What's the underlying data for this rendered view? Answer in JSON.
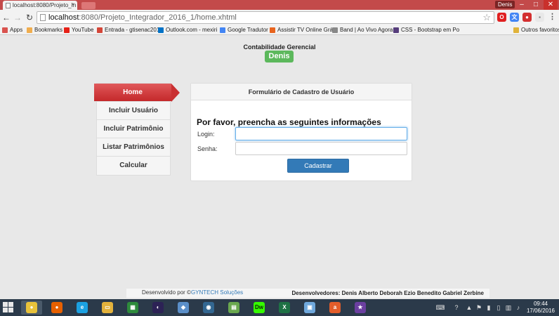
{
  "browser": {
    "tab_title": "localhost:8080/Projeto_In",
    "tab_close": "×",
    "user_badge": "Denis",
    "url_host": "localhost",
    "url_path": ":8080/Projeto_Integrador_2016_1/home.xhtml",
    "bookmarks": [
      {
        "label": "Apps",
        "color": "#d9534f"
      },
      {
        "label": "Bookmarks",
        "color": "#f0ad4e"
      },
      {
        "label": "YouTube",
        "color": "#e62117"
      },
      {
        "label": "Entrada - gtisenac201",
        "color": "#d44638"
      },
      {
        "label": "Outlook.com - mexiri",
        "color": "#0072c6"
      },
      {
        "label": "Google Tradutor",
        "color": "#4285f4"
      },
      {
        "label": "Assistir TV Online Grá",
        "color": "#e8641e"
      },
      {
        "label": "Band | Ao Vivo Agora",
        "color": "#888888"
      },
      {
        "label": "CSS - Bootstrap em Po",
        "color": "#563d7c"
      },
      {
        "label": "Outros favoritos",
        "color": "#e0b33a"
      }
    ]
  },
  "header": {
    "app_title": "Contabilidade Gerencial",
    "user": "Denis"
  },
  "menu": {
    "items": [
      "Home",
      "Incluir Usuário",
      "Incluir Patrimônio",
      "Listar Patrimônios",
      "Calcular"
    ],
    "active_index": 0
  },
  "form": {
    "title": "Formulário de Cadastro de Usuário",
    "intro": "Por favor, preencha as seguintes informações",
    "login_label": "Login:",
    "login_value": "",
    "senha_label": "Senha:",
    "senha_value": "",
    "submit_label": "Cadastrar"
  },
  "footer": {
    "dev_prefix": "Desenvolvido por ©",
    "brand": "GYNTECH Soluções",
    "developers": "Desenvolvedores: Denis Alberto Deborah Ezio Benedito Gabriel Zerbine"
  },
  "taskbar": {
    "time": "09:44",
    "date": "17/06/2016"
  },
  "colors": {
    "active_menu": "#c93032",
    "user_pill": "#5cb85c",
    "primary": "#337ab7"
  }
}
